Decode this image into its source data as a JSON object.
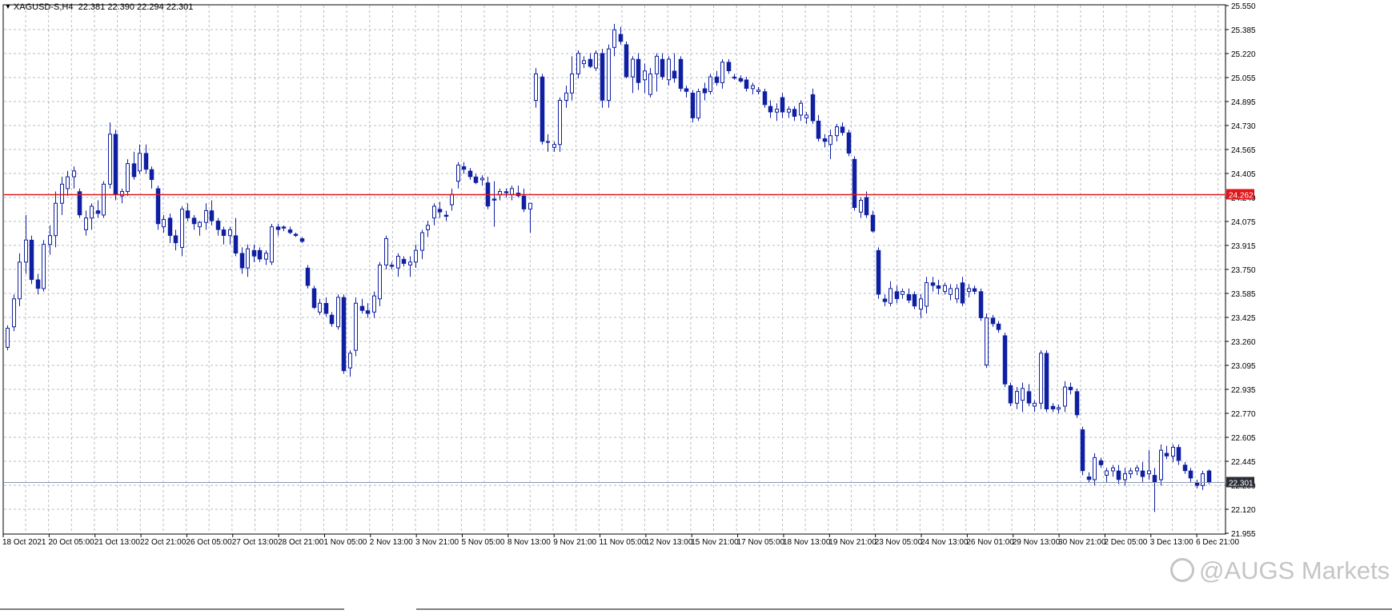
{
  "header": {
    "symbol": "XAGUSD-S,H4",
    "ohlc": "22.381 22.390 22.294 22.301"
  },
  "watermark": {
    "text": "@AUGS Markets"
  },
  "colors": {
    "background": "#ffffff",
    "grid": "#b9bcc4",
    "candle": "#0f1fa1",
    "horizontal_line": "#e0161a",
    "bid_line": "#8a96b2",
    "price_label_bg": "#e0161a",
    "bid_label_bg": "#2a2d36"
  },
  "chart_data": {
    "type": "candlestick",
    "symbol": "XAGUSD-S",
    "timeframe": "H4",
    "grid": true,
    "ylim": [
      21.95,
      25.55
    ],
    "y_ticks": [
      "25.550",
      "25.385",
      "25.220",
      "25.055",
      "24.895",
      "24.730",
      "24.565",
      "24.405",
      "24.240",
      "24.075",
      "23.915",
      "23.750",
      "23.585",
      "23.425",
      "23.260",
      "23.095",
      "22.935",
      "22.770",
      "22.605",
      "22.445",
      "22.280",
      "22.120",
      "21.955"
    ],
    "x_ticks": [
      "18 Oct 2021",
      "20 Oct 05:00",
      "21 Oct 13:00",
      "22 Oct 21:00",
      "26 Oct 05:00",
      "27 Oct 13:00",
      "28 Oct 21:00",
      "1 Nov 05:00",
      "2 Nov 13:00",
      "3 Nov 21:00",
      "5 Nov 05:00",
      "8 Nov 13:00",
      "9 Nov 21:00",
      "11 Nov 05:00",
      "12 Nov 13:00",
      "15 Nov 21:00",
      "17 Nov 05:00",
      "18 Nov 13:00",
      "19 Nov 21:00",
      "23 Nov 05:00",
      "24 Nov 13:00",
      "26 Nov 01:00",
      "29 Nov 13:00",
      "30 Nov 21:00",
      "2 Dec 05:00",
      "3 Dec 13:00",
      "6 Dec 21:00"
    ],
    "horizontal_line": {
      "value": 24.262,
      "label": "24.262"
    },
    "bid_line": {
      "value": 22.301,
      "label": "22.301"
    },
    "candles": [
      [
        23.22,
        23.37,
        23.2,
        23.35
      ],
      [
        23.36,
        23.58,
        23.33,
        23.55
      ],
      [
        23.55,
        23.86,
        23.5,
        23.8
      ],
      [
        23.8,
        24.12,
        23.72,
        23.95
      ],
      [
        23.95,
        23.98,
        23.65,
        23.68
      ],
      [
        23.68,
        23.72,
        23.58,
        23.62
      ],
      [
        23.62,
        23.95,
        23.6,
        23.92
      ],
      [
        23.92,
        24.05,
        23.85,
        23.98
      ],
      [
        23.98,
        24.28,
        23.9,
        24.2
      ],
      [
        24.2,
        24.38,
        24.12,
        24.33
      ],
      [
        24.3,
        24.42,
        24.25,
        24.38
      ],
      [
        24.38,
        24.45,
        24.3,
        24.42
      ],
      [
        24.28,
        24.3,
        24.1,
        24.12
      ],
      [
        24.02,
        24.15,
        23.98,
        24.1
      ],
      [
        24.1,
        24.2,
        24.02,
        24.18
      ],
      [
        24.15,
        24.22,
        24.1,
        24.13
      ],
      [
        24.12,
        24.35,
        24.1,
        24.33
      ],
      [
        24.33,
        24.75,
        24.3,
        24.67
      ],
      [
        24.67,
        24.7,
        24.22,
        24.26
      ],
      [
        24.25,
        24.3,
        24.2,
        24.28
      ],
      [
        24.28,
        24.5,
        24.25,
        24.47
      ],
      [
        24.47,
        24.55,
        24.36,
        24.38
      ],
      [
        24.42,
        24.6,
        24.4,
        24.54
      ],
      [
        24.54,
        24.6,
        24.4,
        24.43
      ],
      [
        24.43,
        24.45,
        24.3,
        24.36
      ],
      [
        24.3,
        24.32,
        24.02,
        24.06
      ],
      [
        24.04,
        24.12,
        24.0,
        24.09
      ],
      [
        24.1,
        24.13,
        23.93,
        23.98
      ],
      [
        23.98,
        24.02,
        23.88,
        23.93
      ],
      [
        23.9,
        24.18,
        23.84,
        24.16
      ],
      [
        24.15,
        24.2,
        24.08,
        24.1
      ],
      [
        24.1,
        24.12,
        24.02,
        24.06
      ],
      [
        24.04,
        24.08,
        23.98,
        24.07
      ],
      [
        24.07,
        24.2,
        24.02,
        24.15
      ],
      [
        24.15,
        24.22,
        24.05,
        24.08
      ],
      [
        24.08,
        24.1,
        23.98,
        24.02
      ],
      [
        24.02,
        24.04,
        23.92,
        23.98
      ],
      [
        23.98,
        24.04,
        23.92,
        24.02
      ],
      [
        23.98,
        24.1,
        23.84,
        23.86
      ],
      [
        23.86,
        23.9,
        23.72,
        23.76
      ],
      [
        23.76,
        23.92,
        23.7,
        23.89
      ],
      [
        23.88,
        23.92,
        23.8,
        23.84
      ],
      [
        23.88,
        23.9,
        23.8,
        23.82
      ],
      [
        23.82,
        23.88,
        23.78,
        23.86
      ],
      [
        23.8,
        24.06,
        23.78,
        24.04
      ],
      [
        24.04,
        24.06,
        23.98,
        24.02
      ],
      [
        24.04,
        24.05,
        24.01,
        24.03
      ],
      [
        24.02,
        24.04,
        23.99,
        24.0
      ],
      [
        23.99,
        24.0,
        23.97,
        23.98
      ],
      [
        23.96,
        23.97,
        23.93,
        23.94
      ],
      [
        23.76,
        23.78,
        23.62,
        23.64
      ],
      [
        23.62,
        23.64,
        23.48,
        23.49
      ],
      [
        23.46,
        23.55,
        23.44,
        23.52
      ],
      [
        23.52,
        23.56,
        23.43,
        23.45
      ],
      [
        23.44,
        23.46,
        23.36,
        23.38
      ],
      [
        23.36,
        23.58,
        23.34,
        23.56
      ],
      [
        23.56,
        23.58,
        23.04,
        23.06
      ],
      [
        23.08,
        23.2,
        23.02,
        23.18
      ],
      [
        23.2,
        23.56,
        23.16,
        23.52
      ],
      [
        23.5,
        23.55,
        23.45,
        23.47
      ],
      [
        23.47,
        23.52,
        23.42,
        23.45
      ],
      [
        23.46,
        23.6,
        23.42,
        23.57
      ],
      [
        23.55,
        23.8,
        23.5,
        23.78
      ],
      [
        23.78,
        23.98,
        23.75,
        23.96
      ],
      [
        23.78,
        23.8,
        23.75,
        23.77
      ],
      [
        23.76,
        23.86,
        23.7,
        23.84
      ],
      [
        23.82,
        23.84,
        23.77,
        23.79
      ],
      [
        23.78,
        23.84,
        23.7,
        23.8
      ],
      [
        23.8,
        23.92,
        23.76,
        23.88
      ],
      [
        23.88,
        24.02,
        23.82,
        24.0
      ],
      [
        24.02,
        24.08,
        23.97,
        24.05
      ],
      [
        24.1,
        24.2,
        24.05,
        24.18
      ],
      [
        24.16,
        24.21,
        24.1,
        24.14
      ],
      [
        24.12,
        24.15,
        24.08,
        24.11
      ],
      [
        24.19,
        24.3,
        24.15,
        24.26
      ],
      [
        24.35,
        24.48,
        24.3,
        24.46
      ],
      [
        24.45,
        24.48,
        24.4,
        24.43
      ],
      [
        24.42,
        24.44,
        24.36,
        24.38
      ],
      [
        24.38,
        24.4,
        24.33,
        24.34
      ],
      [
        24.36,
        24.39,
        24.32,
        24.37
      ],
      [
        24.34,
        24.38,
        24.16,
        24.18
      ],
      [
        24.23,
        24.35,
        24.04,
        24.22
      ],
      [
        24.26,
        24.3,
        24.22,
        24.28
      ],
      [
        24.28,
        24.3,
        24.24,
        24.27
      ],
      [
        24.26,
        24.32,
        24.22,
        24.3
      ],
      [
        24.27,
        24.32,
        24.24,
        24.25
      ],
      [
        24.25,
        24.3,
        24.14,
        24.16
      ],
      [
        24.16,
        24.2,
        24.0,
        24.2
      ],
      [
        24.9,
        25.12,
        24.85,
        25.08
      ],
      [
        25.06,
        25.08,
        24.6,
        24.62
      ],
      [
        24.62,
        24.67,
        24.55,
        24.62
      ],
      [
        24.58,
        24.62,
        24.55,
        24.6
      ],
      [
        24.6,
        24.92,
        24.55,
        24.9
      ],
      [
        24.9,
        25.0,
        24.85,
        24.95
      ],
      [
        24.95,
        25.2,
        24.9,
        25.08
      ],
      [
        25.08,
        25.24,
        25.05,
        25.22
      ],
      [
        25.15,
        25.2,
        25.12,
        25.17
      ],
      [
        25.18,
        25.22,
        25.12,
        25.13
      ],
      [
        25.12,
        25.24,
        25.1,
        25.22
      ],
      [
        25.22,
        25.25,
        24.85,
        24.9
      ],
      [
        24.9,
        25.28,
        24.85,
        25.25
      ],
      [
        25.26,
        25.42,
        25.2,
        25.38
      ],
      [
        25.35,
        25.4,
        25.28,
        25.3
      ],
      [
        25.28,
        25.3,
        25.05,
        25.06
      ],
      [
        25.06,
        25.2,
        24.95,
        25.18
      ],
      [
        25.18,
        25.22,
        24.97,
        25.02
      ],
      [
        25.04,
        25.15,
        24.95,
        25.1
      ],
      [
        24.94,
        25.12,
        24.92,
        25.08
      ],
      [
        25.08,
        25.22,
        24.96,
        25.2
      ],
      [
        25.18,
        25.22,
        25.04,
        25.06
      ],
      [
        25.04,
        25.2,
        25.0,
        25.18
      ],
      [
        25.1,
        25.22,
        25.02,
        25.05
      ],
      [
        25.18,
        25.2,
        24.96,
        24.98
      ],
      [
        24.98,
        25.0,
        24.92,
        24.96
      ],
      [
        24.95,
        24.97,
        24.75,
        24.78
      ],
      [
        24.78,
        24.98,
        24.76,
        24.96
      ],
      [
        24.98,
        25.02,
        24.9,
        24.95
      ],
      [
        24.96,
        25.08,
        24.94,
        25.06
      ],
      [
        25.06,
        25.1,
        25.0,
        25.02
      ],
      [
        25.02,
        25.18,
        24.98,
        25.16
      ],
      [
        25.16,
        25.18,
        25.08,
        25.1
      ],
      [
        25.06,
        25.08,
        25.04,
        25.05
      ],
      [
        25.05,
        25.07,
        25.02,
        25.03
      ],
      [
        25.04,
        25.06,
        24.96,
        24.98
      ],
      [
        24.98,
        25.02,
        24.94,
        25.0
      ],
      [
        24.96,
        24.99,
        24.94,
        24.97
      ],
      [
        24.96,
        24.98,
        24.85,
        24.87
      ],
      [
        24.86,
        24.9,
        24.78,
        24.82
      ],
      [
        24.82,
        24.88,
        24.76,
        24.84
      ],
      [
        24.92,
        24.95,
        24.78,
        24.82
      ],
      [
        24.82,
        24.86,
        24.78,
        24.84
      ],
      [
        24.84,
        24.86,
        24.76,
        24.79
      ],
      [
        24.8,
        24.9,
        24.76,
        24.88
      ],
      [
        24.78,
        24.82,
        24.74,
        24.8
      ],
      [
        24.94,
        24.98,
        24.74,
        24.76
      ],
      [
        24.76,
        24.8,
        24.62,
        24.64
      ],
      [
        24.64,
        24.67,
        24.58,
        24.62
      ],
      [
        24.6,
        24.7,
        24.5,
        24.66
      ],
      [
        24.66,
        24.74,
        24.62,
        24.72
      ],
      [
        24.72,
        24.75,
        24.66,
        24.68
      ],
      [
        24.68,
        24.7,
        24.52,
        24.54
      ],
      [
        24.5,
        24.52,
        24.15,
        24.17
      ],
      [
        24.14,
        24.24,
        24.1,
        24.22
      ],
      [
        24.24,
        24.28,
        24.1,
        24.12
      ],
      [
        24.12,
        24.15,
        24.0,
        24.01
      ],
      [
        23.88,
        23.9,
        23.55,
        23.58
      ],
      [
        23.55,
        23.58,
        23.5,
        23.53
      ],
      [
        23.52,
        23.67,
        23.5,
        23.62
      ],
      [
        23.6,
        23.64,
        23.52,
        23.55
      ],
      [
        23.58,
        23.62,
        23.55,
        23.6
      ],
      [
        23.58,
        23.62,
        23.52,
        23.54
      ],
      [
        23.58,
        23.6,
        23.48,
        23.5
      ],
      [
        23.48,
        23.58,
        23.42,
        23.55
      ],
      [
        23.5,
        23.7,
        23.45,
        23.66
      ],
      [
        23.66,
        23.7,
        23.6,
        23.64
      ],
      [
        23.64,
        23.68,
        23.58,
        23.62
      ],
      [
        23.6,
        23.66,
        23.58,
        23.64
      ],
      [
        23.58,
        23.65,
        23.54,
        23.62
      ],
      [
        23.55,
        23.65,
        23.52,
        23.62
      ],
      [
        23.66,
        23.7,
        23.5,
        23.52
      ],
      [
        23.6,
        23.65,
        23.56,
        23.62
      ],
      [
        23.62,
        23.64,
        23.58,
        23.6
      ],
      [
        23.6,
        23.62,
        23.4,
        23.42
      ],
      [
        23.1,
        23.45,
        23.08,
        23.42
      ],
      [
        23.42,
        23.44,
        23.36,
        23.38
      ],
      [
        23.38,
        23.4,
        23.32,
        23.34
      ],
      [
        23.3,
        23.32,
        22.95,
        22.97
      ],
      [
        22.96,
        22.98,
        22.82,
        22.84
      ],
      [
        22.84,
        22.95,
        22.8,
        22.92
      ],
      [
        22.86,
        22.98,
        22.78,
        22.94
      ],
      [
        22.92,
        22.97,
        22.82,
        22.84
      ],
      [
        22.82,
        22.86,
        22.78,
        22.84
      ],
      [
        22.84,
        23.2,
        22.8,
        23.18
      ],
      [
        23.18,
        23.2,
        22.78,
        22.8
      ],
      [
        22.82,
        22.84,
        22.78,
        22.8
      ],
      [
        22.8,
        22.83,
        22.77,
        22.81
      ],
      [
        22.82,
        22.99,
        22.78,
        22.95
      ],
      [
        22.95,
        22.98,
        22.9,
        22.93
      ],
      [
        22.92,
        22.94,
        22.74,
        22.76
      ],
      [
        22.66,
        22.68,
        22.35,
        22.38
      ],
      [
        22.34,
        22.37,
        22.3,
        22.32
      ],
      [
        22.32,
        22.5,
        22.28,
        22.47
      ],
      [
        22.45,
        22.47,
        22.4,
        22.42
      ],
      [
        22.35,
        22.4,
        22.3,
        22.38
      ],
      [
        22.38,
        22.42,
        22.34,
        22.4
      ],
      [
        22.38,
        22.42,
        22.29,
        22.32
      ],
      [
        22.32,
        22.4,
        22.28,
        22.36
      ],
      [
        22.36,
        22.4,
        22.33,
        22.38
      ],
      [
        22.38,
        22.42,
        22.35,
        22.4
      ],
      [
        22.38,
        22.44,
        22.3,
        22.34
      ],
      [
        22.36,
        22.52,
        22.32,
        22.38
      ],
      [
        22.35,
        22.4,
        22.1,
        22.3
      ],
      [
        22.32,
        22.56,
        22.28,
        22.52
      ],
      [
        22.5,
        22.55,
        22.46,
        22.48
      ],
      [
        22.48,
        22.56,
        22.44,
        22.54
      ],
      [
        22.54,
        22.56,
        22.42,
        22.45
      ],
      [
        22.42,
        22.44,
        22.36,
        22.38
      ],
      [
        22.38,
        22.4,
        22.3,
        22.33
      ],
      [
        22.3,
        22.32,
        22.26,
        22.28
      ],
      [
        22.28,
        22.38,
        22.25,
        22.36
      ],
      [
        22.38,
        22.39,
        22.29,
        22.301
      ]
    ]
  }
}
